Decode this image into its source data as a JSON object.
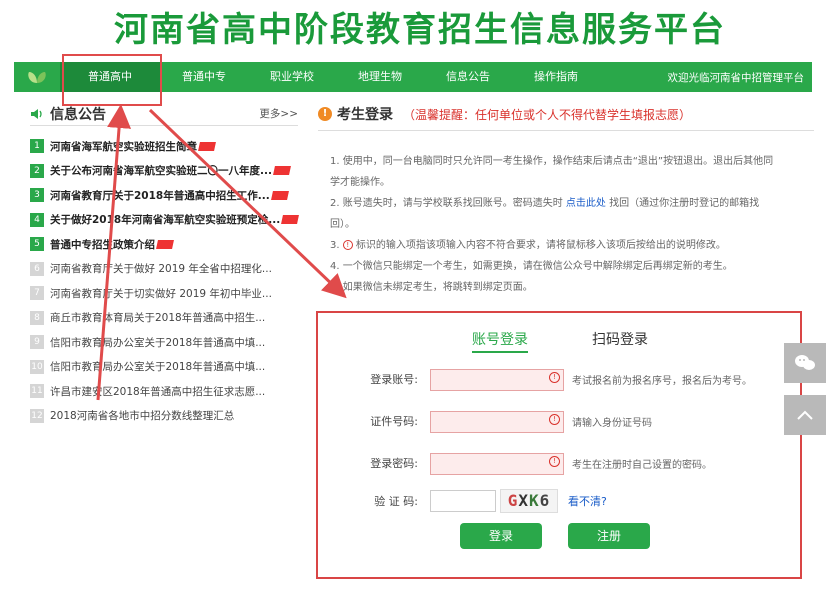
{
  "site": {
    "title": "河南省高中阶段教育招生信息服务平台"
  },
  "nav": {
    "items": [
      {
        "label": "普通高中",
        "active": true
      },
      {
        "label": "普通中专",
        "active": false
      },
      {
        "label": "职业学校",
        "active": false
      },
      {
        "label": "地理生物",
        "active": false
      },
      {
        "label": "信息公告",
        "active": false
      },
      {
        "label": "操作指南",
        "active": false
      }
    ],
    "welcome": "欢迎光临河南省中招管理平台"
  },
  "info": {
    "title": "信息公告",
    "more": "更多>>",
    "items": [
      {
        "num": "1",
        "text": "河南省海军航空实验班招生简章",
        "bold": true,
        "new": true
      },
      {
        "num": "2",
        "text": "关于公布河南省海军航空实验班二〇一八年度...",
        "bold": true,
        "new": true
      },
      {
        "num": "3",
        "text": "河南省教育厅关于2018年普通高中招生工作...",
        "bold": true,
        "new": true
      },
      {
        "num": "4",
        "text": "关于做好2018年河南省海军航空实验班预定检...",
        "bold": true,
        "new": true
      },
      {
        "num": "5",
        "text": "普通中专招生政策介绍",
        "bold": true,
        "new": true
      },
      {
        "num": "6",
        "text": "河南省教育厅关于做好 2019 年全省中招理化...",
        "bold": false,
        "new": false
      },
      {
        "num": "7",
        "text": "河南省教育厅关于切实做好 2019 年初中毕业...",
        "bold": false,
        "new": false
      },
      {
        "num": "8",
        "text": "商丘市教育体育局关于2018年普通高中招生...",
        "bold": false,
        "new": false
      },
      {
        "num": "9",
        "text": "信阳市教育局办公室关于2018年普通高中填...",
        "bold": false,
        "new": false
      },
      {
        "num": "10",
        "text": "信阳市教育局办公室关于2018年普通高中填...",
        "bold": false,
        "new": false
      },
      {
        "num": "11",
        "text": "许昌市建安区2018年普通高中招生征求志愿...",
        "bold": false,
        "new": false
      },
      {
        "num": "12",
        "text": "2018河南省各地市中招分数线整理汇总",
        "bold": false,
        "new": false
      }
    ]
  },
  "login": {
    "title": "考生登录",
    "tip": "（温馨提醒：任何单位或个人不得代替学生填报志愿）",
    "instructions": {
      "i1": "1. 使用中，同一台电脑同时只允许同一考生操作，操作结束后请点击“退出”按钮退出。退出后其他同学才能操作。",
      "i2a": "2. 账号遗失时，请与学校联系找回账号。密码遗失时 ",
      "i2link": "点击此处",
      "i2b": " 找回（通过你注册时登记的邮箱找回）。",
      "i3": " 标识的输入项指该项输入内容不符合要求，请将鼠标移入该项后按给出的说明修改。",
      "i4": "4. 一个微信只能绑定一个考生，如需更换，请在微信公众号中解除绑定后再绑定新的考生。",
      "i5": "5. 如果微信未绑定考生，将跳转到绑定页面。"
    },
    "tabs": {
      "account": "账号登录",
      "qrcode": "扫码登录"
    },
    "fields": {
      "account_label": "登录账号:",
      "account_hint": "考试报名前为报名序号，报名后为考号。",
      "id_label": "证件号码:",
      "id_hint": "请输入身份证号码",
      "pwd_label": "登录密码:",
      "pwd_hint": "考生在注册时自己设置的密码。",
      "captcha_label": "验 证 码:",
      "captcha_chars": [
        "G",
        "X",
        "K",
        "6"
      ],
      "refresh": "看不清?"
    },
    "buttons": {
      "login": "登录",
      "register": "注册"
    }
  },
  "colors": {
    "brand": "#2aa84a",
    "alert": "#d9322c",
    "annotation": "#e04b4b"
  }
}
